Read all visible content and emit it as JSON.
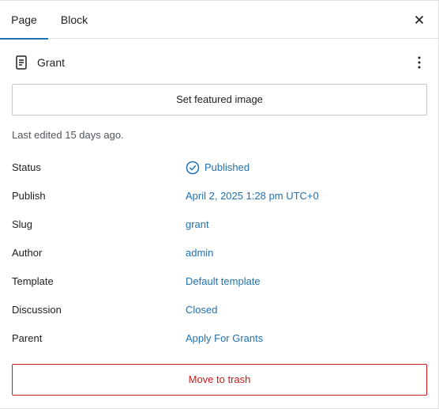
{
  "tabs": [
    {
      "label": "Page",
      "active": true
    },
    {
      "label": "Block",
      "active": false
    }
  ],
  "header": {
    "close_icon": "close-icon"
  },
  "document": {
    "icon": "page-icon",
    "title": "Grant",
    "more_icon": "more-vertical-icon"
  },
  "featured_image": {
    "label": "Set featured image"
  },
  "last_edited": "Last edited 15 days ago.",
  "fields": {
    "status": {
      "label": "Status",
      "value": "Published",
      "icon": "published-check-icon"
    },
    "publish": {
      "label": "Publish",
      "value": "April 2, 2025 1:28 pm UTC+0"
    },
    "slug": {
      "label": "Slug",
      "value": "grant"
    },
    "author": {
      "label": "Author",
      "value": "admin"
    },
    "template": {
      "label": "Template",
      "value": "Default template"
    },
    "discussion": {
      "label": "Discussion",
      "value": "Closed"
    },
    "parent": {
      "label": "Parent",
      "value": "Apply For Grants"
    }
  },
  "trash": {
    "label": "Move to trash"
  },
  "colors": {
    "accent": "#2271b1",
    "danger": "#cc1818",
    "text": "#1e1e1e",
    "muted": "#50575e",
    "border": "#e0e0e0"
  }
}
